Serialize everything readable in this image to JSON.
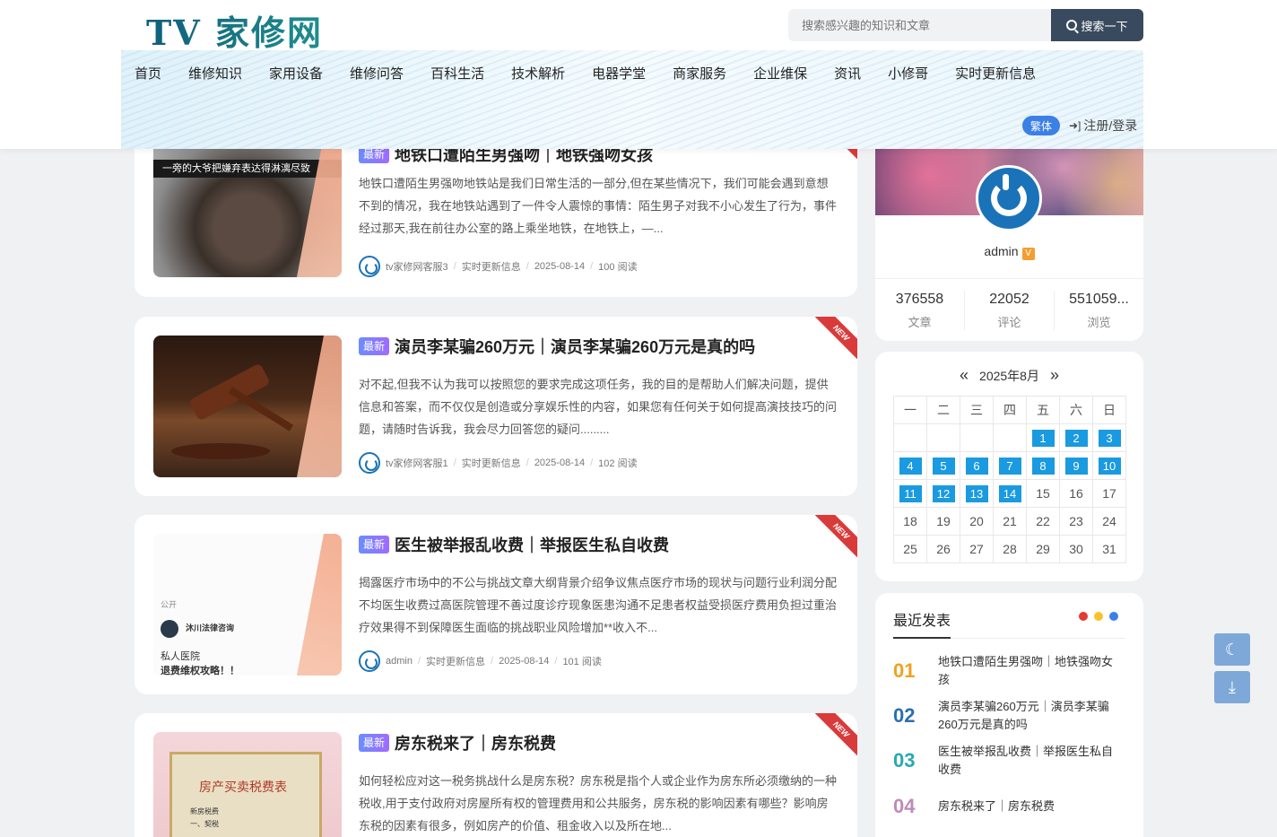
{
  "header": {
    "logo": "TV 家修网",
    "search_placeholder": "搜索感兴趣的知识和文章",
    "search_button": "搜索一下",
    "nav": [
      "首页",
      "维修知识",
      "家用设备",
      "维修问答",
      "百科生活",
      "技术解析",
      "电器学堂",
      "商家服务",
      "企业维保",
      "资讯",
      "小修哥",
      "实时更新信息"
    ],
    "lang_toggle": "繁体",
    "login": "注册/登录"
  },
  "posts": [
    {
      "badge": "最新",
      "title": "地铁口遭陌生男强吻｜地铁强吻女孩",
      "excerpt": "地铁口遭陌生男强吻地铁站是我们日常生活的一部分,但在某些情况下，我们可能会遇到意想不到的情况，我在地铁站遇到了一件令人震惊的事情：陌生男子对我不小心发生了行为，事件经过那天,我在前往办公室的路上乘坐地铁，在地铁上，—...",
      "author": "tv家修网客服3",
      "category": "实时更新信息",
      "date": "2025-08-14",
      "views": "100 阅读",
      "thumb_caption": "一旁的大爷把嫌弃表达得淋漓尽致",
      "ribbon": "NEW"
    },
    {
      "badge": "最新",
      "title": "演员李某骗260万元｜演员李某骗260万元是真的吗",
      "excerpt": "对不起,但我不认为我可以按照您的要求完成这项任务，我的目的是帮助人们解决问题，提供信息和答案，而不仅仅是创造或分享娱乐性的内容，如果您有任何关于如何提高演技技巧的问题，请随时告诉我，我会尽力回答您的疑问.........",
      "author": "tv家修网客服1",
      "category": "实时更新信息",
      "date": "2025-08-14",
      "views": "102 阅读",
      "ribbon": "NEW"
    },
    {
      "badge": "最新",
      "title": "医生被举报乱收费｜举报医生私自收费",
      "excerpt": "揭露医疗市场中的不公与挑战文章大纲背景介绍争议焦点医疗市场的现状与问题行业利润分配不均医生收费过高医院管理不善过度诊疗现象医患沟通不足患者权益受损医疗费用负担过重治疗效果得不到保障医生面临的挑战职业风险增加**收入不...",
      "author": "admin",
      "category": "实时更新信息",
      "date": "2025-08-14",
      "views": "101 阅读",
      "thumb_lines": [
        "公开",
        "沐川法律咨询",
        "私人医院",
        "退费维权攻略！！"
      ],
      "ribbon": "NEW"
    },
    {
      "badge": "最新",
      "title": "房东税来了｜房东税费",
      "excerpt": "如何轻松应对这一税务挑战什么是房东税？房东税是指个人或企业作为房东所必须缴纳的一种税收,用于支付政府对房屋所有权的管理费用和公共服务，房东税的影响因素有哪些？影响房东税的因素有很多，例如房产的价值、租金收入以及所在地...",
      "thumb_lines": [
        "房产买卖税费表",
        "新房税费",
        "一、契税"
      ],
      "ribbon": "NEW"
    }
  ],
  "profile": {
    "name": "admin",
    "vip": "V",
    "stats": [
      {
        "num": "376558",
        "label": "文章"
      },
      {
        "num": "22052",
        "label": "评论"
      },
      {
        "num": "551059...",
        "label": "浏览"
      }
    ]
  },
  "calendar": {
    "month": "2025年8月",
    "prev": "«",
    "next": "»",
    "weekdays": [
      "一",
      "二",
      "三",
      "四",
      "五",
      "六",
      "日"
    ],
    "weeks": [
      [
        "",
        "",
        "",
        "",
        "1",
        "2",
        "3"
      ],
      [
        "4",
        "5",
        "6",
        "7",
        "8",
        "9",
        "10"
      ],
      [
        "11",
        "12",
        "13",
        "14",
        "15",
        "16",
        "17"
      ],
      [
        "18",
        "19",
        "20",
        "21",
        "22",
        "23",
        "24"
      ],
      [
        "25",
        "26",
        "27",
        "28",
        "29",
        "30",
        "31"
      ]
    ],
    "linked_days": [
      "1",
      "2",
      "3",
      "4",
      "5",
      "6",
      "7",
      "8",
      "9",
      "10",
      "11",
      "12",
      "13",
      "14"
    ]
  },
  "recent": {
    "title": "最近发表",
    "dot_colors": [
      "#e53935",
      "#fbc02d",
      "#3c80e6"
    ],
    "items": [
      {
        "rank": "01",
        "color": "#f0a020",
        "text": "地铁口遭陌生男强吻｜地铁强吻女孩"
      },
      {
        "rank": "02",
        "color": "#2a6fb0",
        "text": "演员李某骗260万元｜演员李某骗260万元是真的吗"
      },
      {
        "rank": "03",
        "color": "#2aa8b0",
        "text": "医生被举报乱收费｜举报医生私自收费"
      },
      {
        "rank": "04",
        "color": "#c08ab8",
        "text": "房东税来了｜房东税费"
      }
    ]
  },
  "float_buttons": [
    "moon-icon",
    "download-icon"
  ]
}
